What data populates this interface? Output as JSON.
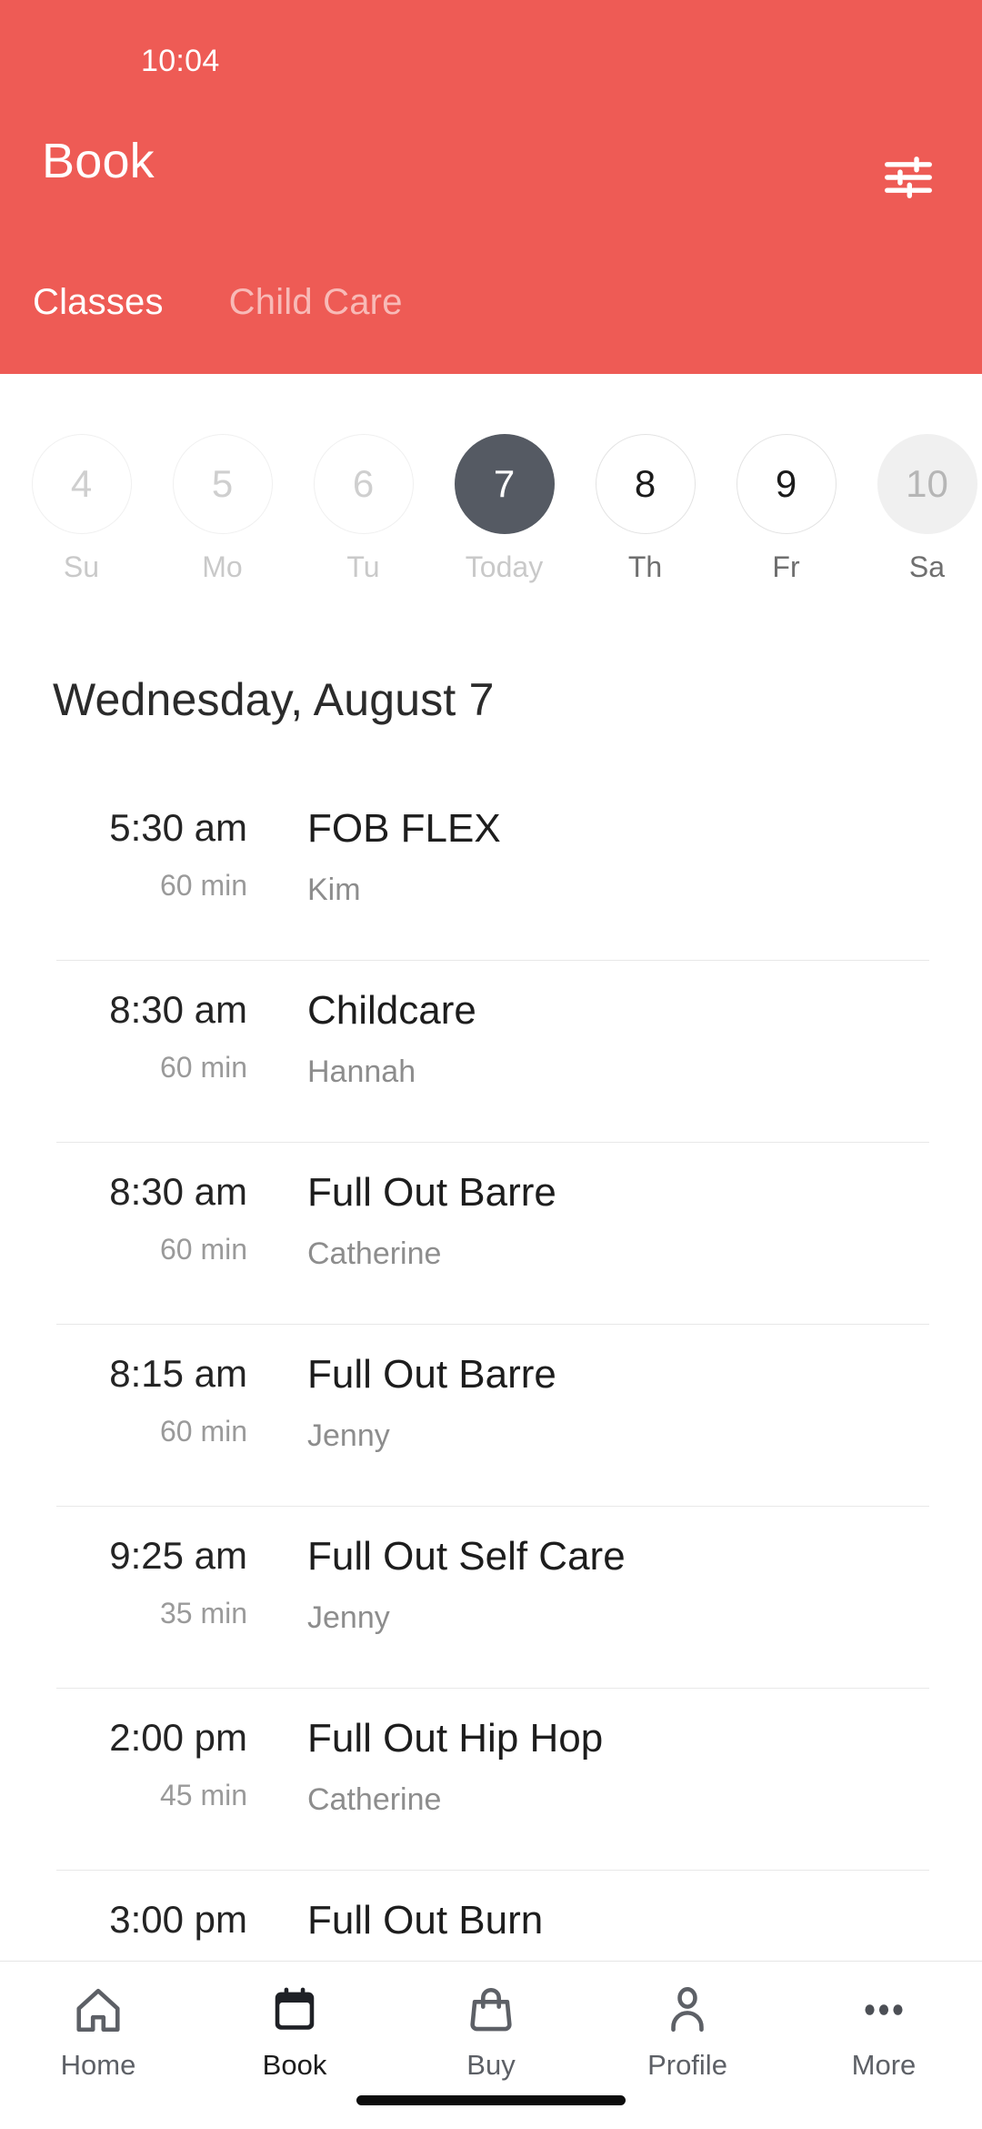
{
  "status_bar": {
    "time": "10:04"
  },
  "header": {
    "title": "Book",
    "accent_color": "#ee5b55",
    "filter_icon": "tune-icon",
    "tabs": [
      {
        "label": "Classes",
        "active": true
      },
      {
        "label": "Child Care",
        "active": false
      }
    ]
  },
  "date_strip": {
    "days": [
      {
        "number": "4",
        "label": "Su",
        "state": "past"
      },
      {
        "number": "5",
        "label": "Mo",
        "state": "past"
      },
      {
        "number": "6",
        "label": "Tu",
        "state": "past"
      },
      {
        "number": "7",
        "label": "Today",
        "state": "today"
      },
      {
        "number": "8",
        "label": "Th",
        "state": "future"
      },
      {
        "number": "9",
        "label": "Fr",
        "state": "future"
      },
      {
        "number": "10",
        "label": "Sa",
        "state": "muted"
      }
    ],
    "selected_color": "#555a63"
  },
  "day_heading": "Wednesday, August 7",
  "classes": [
    {
      "time": "5:30 am",
      "duration": "60 min",
      "name": "FOB FLEX",
      "coach": "Kim"
    },
    {
      "time": "8:30 am",
      "duration": "60 min",
      "name": "Childcare",
      "coach": "Hannah"
    },
    {
      "time": "8:30 am",
      "duration": "60 min",
      "name": "Full Out Barre",
      "coach": "Catherine"
    },
    {
      "time": "8:15 am",
      "duration": "60 min",
      "name": "Full Out Barre",
      "coach": "Jenny"
    },
    {
      "time": "9:25 am",
      "duration": "35 min",
      "name": "Full Out Self Care",
      "coach": "Jenny"
    },
    {
      "time": "2:00 pm",
      "duration": "45 min",
      "name": "Full Out Hip Hop",
      "coach": "Catherine"
    },
    {
      "time": "3:00 pm",
      "duration": "",
      "name": "Full Out Burn",
      "coach": ""
    }
  ],
  "bottom_nav": {
    "items": [
      {
        "label": "Home",
        "icon": "home-icon",
        "active": false
      },
      {
        "label": "Book",
        "icon": "calendar-icon",
        "active": true
      },
      {
        "label": "Buy",
        "icon": "bag-icon",
        "active": false
      },
      {
        "label": "Profile",
        "icon": "person-icon",
        "active": false
      },
      {
        "label": "More",
        "icon": "ellipsis-icon",
        "active": false
      }
    ]
  }
}
